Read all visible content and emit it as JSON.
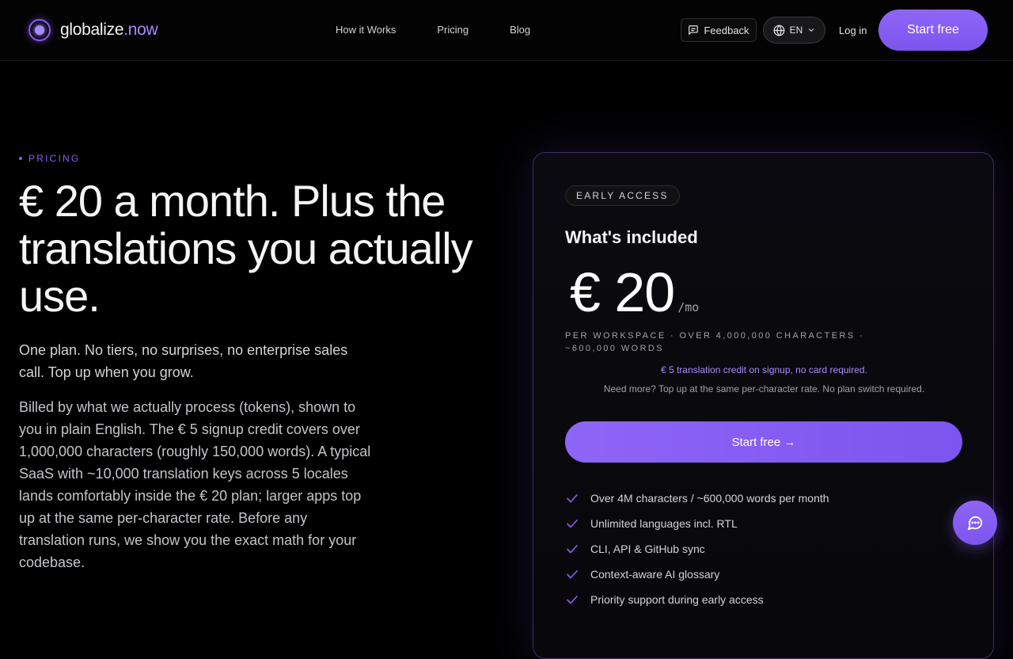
{
  "header": {
    "logo_main": "globalize",
    "logo_accent": ".now",
    "nav": [
      {
        "label": "How it Works"
      },
      {
        "label": "Pricing"
      },
      {
        "label": "Blog"
      }
    ],
    "feedback_label": "Feedback",
    "language_label": "EN",
    "login_label": "Log in",
    "cta_label": "Start free"
  },
  "hero": {
    "eyebrow": "PRICING",
    "headline": "€ 20 a month. Plus the translations you actually use.",
    "lead": "One plan. No tiers, no surprises, no enterprise sales call. Top up when you grow.",
    "body": "Billed by what we actually process (tokens), shown to you in plain English. The € 5 signup credit covers over 1,000,000 characters (roughly 150,000 words). A typical SaaS with ~10,000 translation keys across 5 locales lands comfortably inside the € 20 plan; larger apps top up at the same per-character rate. Before any translation runs, we show you the exact math for your codebase."
  },
  "card": {
    "badge": "EARLY ACCESS",
    "title": "What's included",
    "price": "€ 20",
    "price_unit": "/mo",
    "meta": "PER WORKSPACE · OVER 4,000,000 CHARACTERS · ~600,000 WORDS",
    "credit_note": "€ 5 translation credit on signup, no card required.",
    "topup_note": "Need more? Top up at the same per-character rate. No plan switch required.",
    "cta_label": "Start free →",
    "features": [
      "Over 4M characters / ~600,000 words per month",
      "Unlimited languages incl. RTL",
      "CLI, API & GitHub sync",
      "Context-aware AI glossary",
      "Priority support during early access"
    ]
  },
  "colors": {
    "accent": "#8b5cf6",
    "accent_light": "#a78bfa",
    "background": "#000000"
  },
  "icons": {
    "feedback": "message-square-icon",
    "language": "globe-icon",
    "dropdown": "chevron-down-icon",
    "feature": "check-icon",
    "chat": "chat-bubble-icon"
  }
}
